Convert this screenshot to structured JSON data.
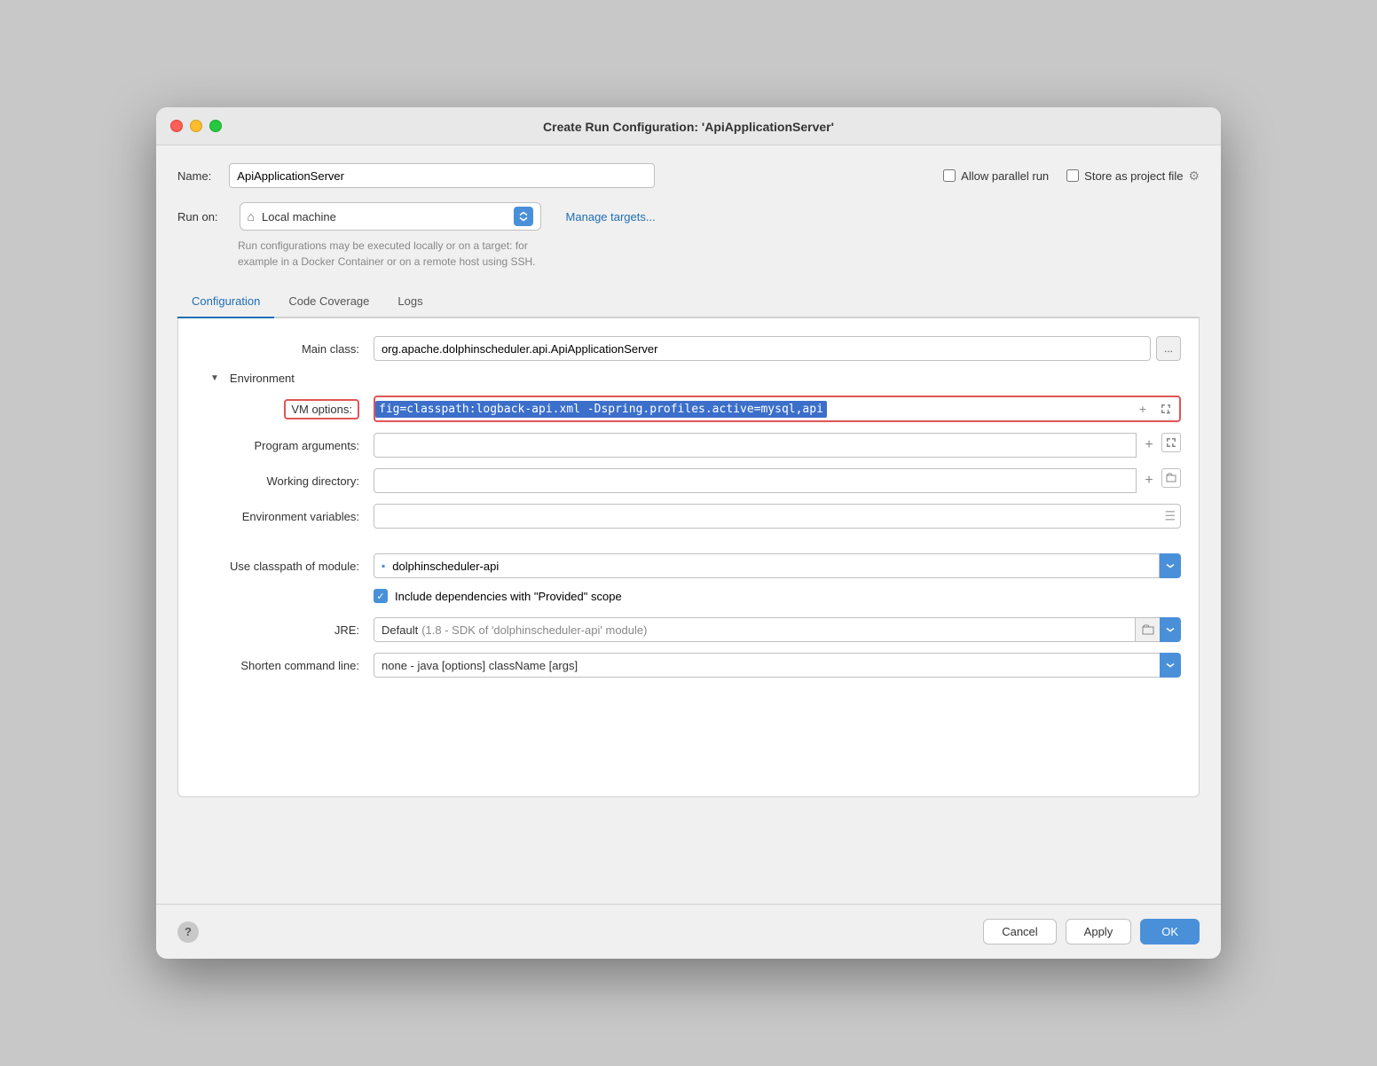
{
  "dialog": {
    "title": "Create Run Configuration: 'ApiApplicationServer'",
    "name_label": "Name:",
    "name_value": "ApiApplicationServer",
    "allow_parallel_label": "Allow parallel run",
    "store_project_label": "Store as project file",
    "run_on_label": "Run on:",
    "run_on_value": "Local machine",
    "manage_targets_label": "Manage targets...",
    "run_on_hint": "Run configurations may be executed locally or on a target: for\nexample in a Docker Container or on a remote host using SSH.",
    "tabs": [
      {
        "label": "Configuration",
        "active": true
      },
      {
        "label": "Code Coverage",
        "active": false
      },
      {
        "label": "Logs",
        "active": false
      }
    ],
    "main_class_label": "Main class:",
    "main_class_value": "org.apache.dolphinscheduler.api.ApiApplicationServer",
    "environment_label": "Environment",
    "vm_options_label": "VM options:",
    "vm_options_value": "fig=classpath:logback-api.xml -Dspring.profiles.active=mysql,api",
    "program_args_label": "Program arguments:",
    "program_args_value": "",
    "working_dir_label": "Working directory:",
    "working_dir_value": "",
    "env_vars_label": "Environment variables:",
    "env_vars_value": "",
    "classpath_label": "Use classpath of module:",
    "classpath_value": "dolphinscheduler-api",
    "include_deps_label": "Include dependencies with \"Provided\" scope",
    "jre_label": "JRE:",
    "jre_value": "Default",
    "jre_detail": "(1.8 - SDK of 'dolphinscheduler-api' module)",
    "shorten_label": "Shorten command line:",
    "shorten_value": "none - java [options] className [args]",
    "cancel_label": "Cancel",
    "apply_label": "Apply",
    "ok_label": "OK",
    "help_label": "?"
  }
}
